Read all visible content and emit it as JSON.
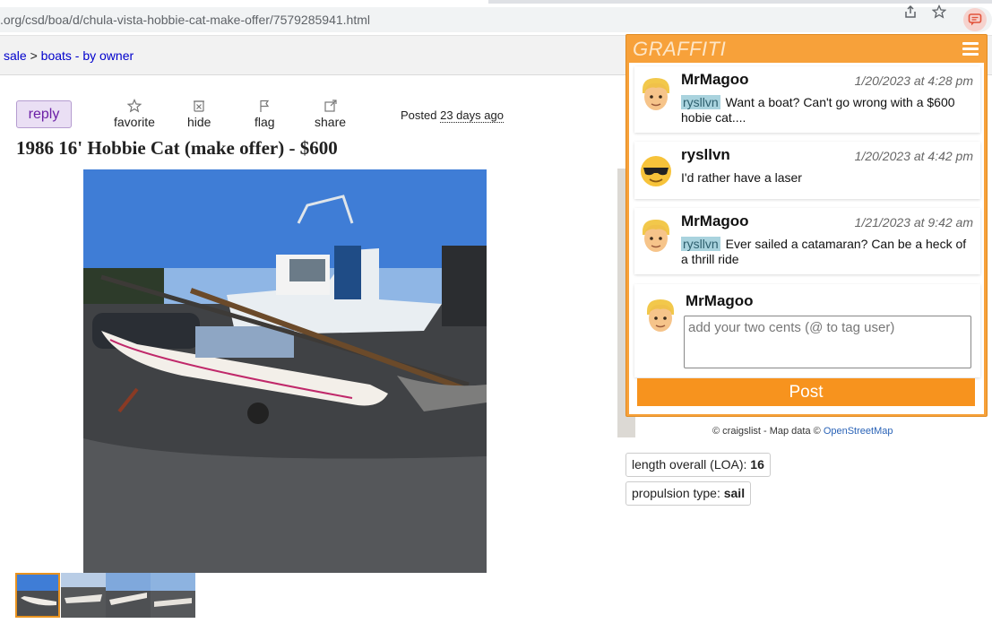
{
  "browser": {
    "url_host": ".org",
    "url_path": "/csd/boa/d/chula-vista-hobbie-cat-make-offer/7579285941.html",
    "icons": [
      "share-icon",
      "bookmark-star-icon",
      "graffiti-extension-icon"
    ]
  },
  "breadcrumb": {
    "items": [
      {
        "label": "sale"
      },
      {
        "label": "boats - by owner"
      }
    ],
    "separator": ">"
  },
  "posting": {
    "reply_label": "reply",
    "actions": [
      {
        "label": "favorite",
        "icon": "star-icon"
      },
      {
        "label": "hide",
        "icon": "hide-icon"
      },
      {
        "label": "flag",
        "icon": "flag-icon"
      },
      {
        "label": "share",
        "icon": "share-icon"
      }
    ],
    "posted_label": "Posted",
    "posted_ago": "23 days ago",
    "title": "1986 16' Hobbie Cat (make offer) - $600",
    "thumbnail_count": 4,
    "selected_thumbnail": 0
  },
  "map": {
    "credit_prefix": "© craigslist - Map data ©",
    "credit_link": "OpenStreetMap"
  },
  "attributes": [
    {
      "label": "length overall (LOA):",
      "value": "16"
    },
    {
      "label": "propulsion type:",
      "value": "sail"
    }
  ],
  "graffiti": {
    "brand": "GRAFFITI",
    "comments": [
      {
        "user": "MrMagoo",
        "time": "1/20/2023 at 4:28 pm",
        "tag": "rysllvn",
        "text": "Want a boat? Can't go wrong with a $600 hobie cat....",
        "avatar": "blond-person-avatar"
      },
      {
        "user": "rysllvn",
        "time": "1/20/2023 at 4:42 pm",
        "tag": "",
        "text": "I'd rather have a laser",
        "avatar": "sunglasses-face-avatar"
      },
      {
        "user": "MrMagoo",
        "time": "1/21/2023 at 9:42 am",
        "tag": "rysllvn",
        "text": "Ever sailed a catamaran? Can be a heck of a thrill ride",
        "avatar": "blond-person-avatar"
      }
    ],
    "composer": {
      "user": "MrMagoo",
      "placeholder": "add your two cents (@ to tag user)",
      "post_label": "Post"
    },
    "accent_color": "#f7931e"
  }
}
